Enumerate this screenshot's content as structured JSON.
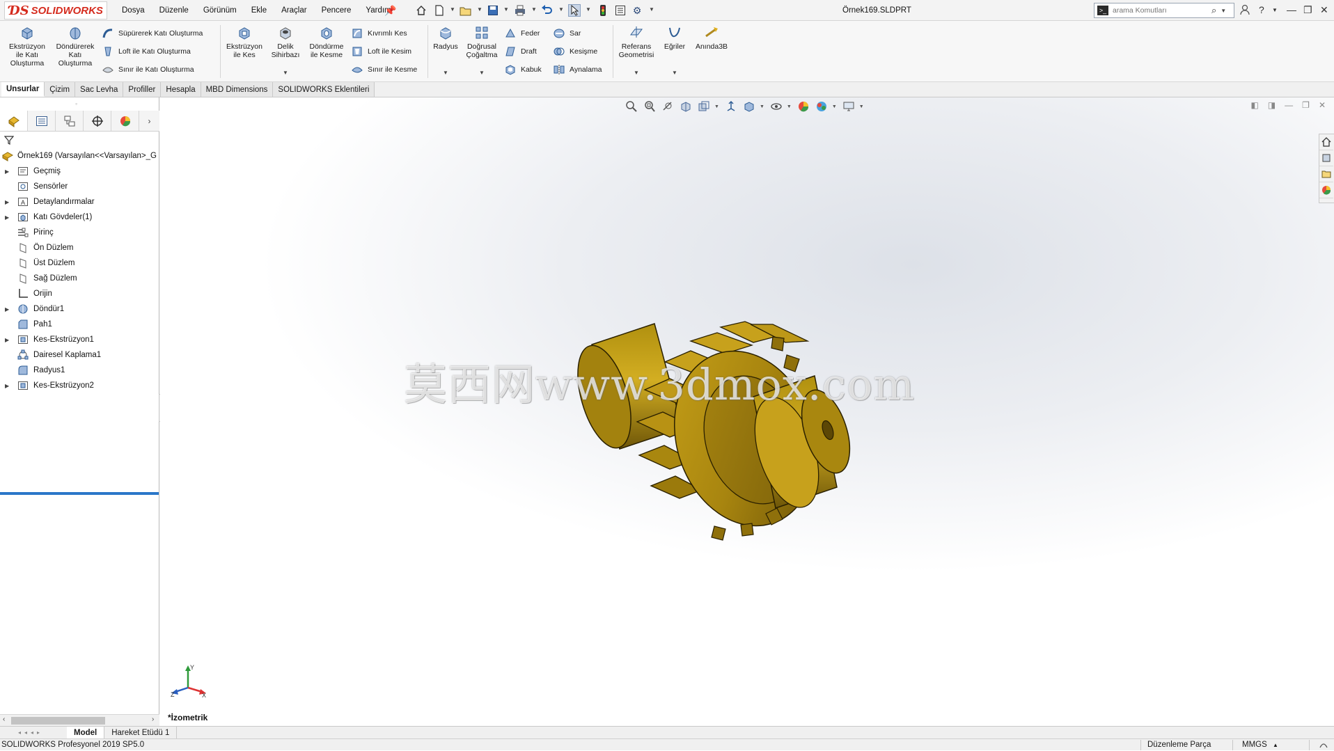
{
  "app": {
    "brand": "SOLIDWORKS",
    "doc_title": "Örnek169.SLDPRT"
  },
  "menu": [
    "Dosya",
    "Düzenle",
    "Görünüm",
    "Ekle",
    "Araçlar",
    "Pencere",
    "Yardım"
  ],
  "search": {
    "placeholder": "arama Komutları"
  },
  "ribbon": {
    "extrude_boss": "Ekstrüzyon\nile Katı\nOluşturma",
    "revolve_boss": "Döndürerek\nKatı\nOluşturma",
    "swept_boss": "Süpürerek Katı Oluşturma",
    "loft_boss": "Loft ile Katı Oluşturma",
    "boundary_boss": "Sınır ile Katı Oluşturma",
    "extrude_cut": "Ekstrüzyon\nile Kes",
    "hole_wizard": "Delik\nSihirbazı",
    "revolve_cut": "Döndürme\nile Kesme",
    "swept_cut": "Kıvrımlı Kes",
    "loft_cut": "Loft ile Kesim",
    "boundary_cut": "Sınır ile Kesme",
    "fillet": "Radyus",
    "linear_pattern": "Doğrusal\nÇoğaltma",
    "rib": "Feder",
    "draft": "Draft",
    "shell": "Kabuk",
    "wrap": "Sar",
    "intersect": "Kesişme",
    "mirror": "Aynalama",
    "ref_geometry": "Referans\nGeometrisi",
    "curves": "Eğriler",
    "instant3d": "Anında3B"
  },
  "command_tabs": [
    "Unsurlar",
    "Çizim",
    "Sac Levha",
    "Profiller",
    "Hesapla",
    "MBD Dimensions",
    "SOLIDWORKS Eklentileri"
  ],
  "feature_tree": [
    {
      "label": "Örnek169  (Varsayılan<<Varsayılan>_G",
      "icon": "part-icon",
      "expandable": false,
      "root": true
    },
    {
      "label": "Geçmiş",
      "icon": "history-icon",
      "expandable": true
    },
    {
      "label": "Sensörler",
      "icon": "sensor-icon",
      "expandable": false
    },
    {
      "label": "Detaylandırmalar",
      "icon": "annotation-icon",
      "expandable": true
    },
    {
      "label": "Katı Gövdeler(1)",
      "icon": "solid-bodies-icon",
      "expandable": true
    },
    {
      "label": "Pirinç",
      "icon": "material-icon",
      "expandable": false
    },
    {
      "label": "Ön Düzlem",
      "icon": "plane-icon",
      "expandable": false
    },
    {
      "label": "Üst Düzlem",
      "icon": "plane-icon",
      "expandable": false
    },
    {
      "label": "Sağ Düzlem",
      "icon": "plane-icon",
      "expandable": false
    },
    {
      "label": "Orijin",
      "icon": "origin-icon",
      "expandable": false
    },
    {
      "label": "Döndür1",
      "icon": "revolve-feature-icon",
      "expandable": true
    },
    {
      "label": "Pah1",
      "icon": "chamfer-feature-icon",
      "expandable": false
    },
    {
      "label": "Kes-Ekstrüzyon1",
      "icon": "cut-extrude-feature-icon",
      "expandable": true
    },
    {
      "label": "Dairesel Kaplama1",
      "icon": "circular-pattern-feature-icon",
      "expandable": false
    },
    {
      "label": "Radyus1",
      "icon": "fillet-feature-icon",
      "expandable": false
    },
    {
      "label": "Kes-Ekstrüzyon2",
      "icon": "cut-extrude-feature-icon",
      "expandable": true
    }
  ],
  "viewport": {
    "watermark": "莫西网www.3dmox.com",
    "view_name": "*İzometrik",
    "part_color": "#8a6c0c"
  },
  "bottom_tabs": [
    "Model",
    "Hareket Etüdü 1"
  ],
  "status": {
    "product": "SOLIDWORKS Profesyonel 2019 SP5.0",
    "mode": "Düzenleme Parça",
    "units": "MMGS"
  }
}
